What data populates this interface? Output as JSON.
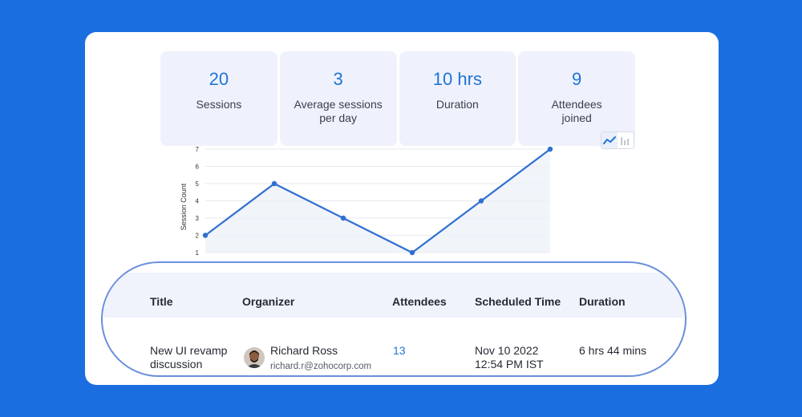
{
  "stats": [
    {
      "value": "20",
      "label": "Sessions"
    },
    {
      "value": "3",
      "label": "Average sessions per day"
    },
    {
      "value": "10 hrs",
      "label": "Duration"
    },
    {
      "value": "9",
      "label": "Attendees joined"
    }
  ],
  "toggle": {
    "active": "line-chart-icon",
    "inactive": "bar-chart-icon"
  },
  "chart_data": {
    "type": "line",
    "x": [
      1,
      2,
      3,
      4,
      5,
      6
    ],
    "values": [
      2,
      5,
      3,
      1,
      4,
      7
    ],
    "ylabel": "Session Count",
    "ylim": [
      1,
      7
    ],
    "yticks": [
      "1",
      "2",
      "3",
      "4",
      "5",
      "6",
      "7"
    ],
    "color": "#2f6fd0",
    "grid": true
  },
  "table": {
    "headers": {
      "title": "Title",
      "organizer": "Organizer",
      "attendees": "Attendees",
      "scheduled": "Scheduled Time",
      "duration": "Duration"
    },
    "rows": [
      {
        "title_line1": "New UI revamp",
        "title_line2": "discussion",
        "organizer_name": "Richard Ross",
        "organizer_email": "richard.r@zohocorp.com",
        "attendees": "13",
        "scheduled_line1": "Nov 10 2022",
        "scheduled_line2": "12:54 PM IST",
        "duration": "6 hrs 44 mins"
      }
    ]
  },
  "colors": {
    "background": "#1a6ee0",
    "accent": "#1f73d8",
    "table_outline": "#6a8fdc"
  }
}
